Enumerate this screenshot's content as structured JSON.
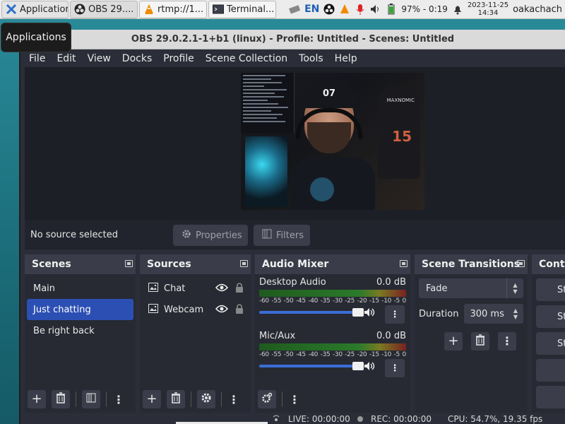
{
  "taskbar": {
    "applications_label": "Applications",
    "tasks": [
      {
        "label": "OBS 29...."
      },
      {
        "label": "rtmp://1..."
      },
      {
        "label": "Terminal..."
      }
    ],
    "language": "EN",
    "battery": "97% - 0:19",
    "date": "2023-11-25",
    "time": "14:34",
    "user": "oakachach"
  },
  "tooltip": "Applications",
  "window": {
    "title": "OBS 29.0.2.1-1+b1 (linux) - Profile: Untitled - Scenes: Untitled",
    "menu": [
      "File",
      "Edit",
      "View",
      "Docks",
      "Profile",
      "Scene Collection",
      "Tools",
      "Help"
    ]
  },
  "preview": {
    "beanie_text": "07",
    "chair_logo": "MAXNOMIC",
    "chair_number": "15"
  },
  "sourcebar": {
    "status": "No source selected",
    "properties_label": "Properties",
    "filters_label": "Filters"
  },
  "scenes": {
    "title": "Scenes",
    "items": [
      "Main",
      "Just chatting",
      "Be right back"
    ],
    "selected_index": 1
  },
  "sources": {
    "title": "Sources",
    "items": [
      "Chat",
      "Webcam"
    ]
  },
  "mixer": {
    "title": "Audio Mixer",
    "scale": [
      "-60",
      "-55",
      "-50",
      "-45",
      "-40",
      "-35",
      "-30",
      "-25",
      "-20",
      "-15",
      "-10",
      "-5",
      "0"
    ],
    "channels": [
      {
        "name": "Desktop Audio",
        "level": "0.0 dB",
        "volume": 1.0
      },
      {
        "name": "Mic/Aux",
        "level": "0.0 dB",
        "volume": 1.0
      }
    ]
  },
  "transitions": {
    "title": "Scene Transitions",
    "selected": "Fade",
    "duration_label": "Duration",
    "duration_value": "300 ms"
  },
  "controls": {
    "title": "Contr",
    "buttons": [
      "Sta",
      "Sta",
      "St",
      "",
      ""
    ]
  },
  "status": {
    "live": "LIVE: 00:00:00",
    "rec": "REC: 00:00:00",
    "cpu": "CPU: 54.7%, 19.35 fps"
  },
  "colors": {
    "accent": "#2c4fb3",
    "dock_bg": "#272a33",
    "header_bg": "#3a3d49"
  }
}
